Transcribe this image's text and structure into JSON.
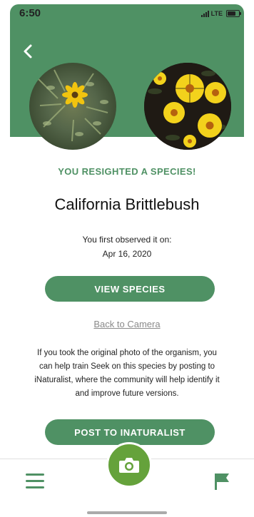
{
  "status_bar": {
    "time": "6:50",
    "network": "LTE"
  },
  "header": {
    "back_icon": "chevron-left-icon"
  },
  "main": {
    "resighted_label": "YOU RESIGHTED A SPECIES!",
    "species_name": "California Brittlebush",
    "first_observed_label": "You first observed it on:",
    "first_observed_date": "Apr 16, 2020",
    "view_species_button": "VIEW SPECIES",
    "back_to_camera_link": "Back to Camera",
    "info_text": "If you took the original photo of the organism, you can help train Seek on this species by posting to iNaturalist, where the community will help identify it and improve future versions.",
    "post_button": "POST TO INATURALIST"
  },
  "bottom_nav": {
    "menu_icon": "hamburger-menu-icon",
    "camera_icon": "camera-icon",
    "flag_icon": "flag-icon"
  },
  "colors": {
    "brand_green": "#4f9164",
    "camera_green": "#65a23b"
  }
}
